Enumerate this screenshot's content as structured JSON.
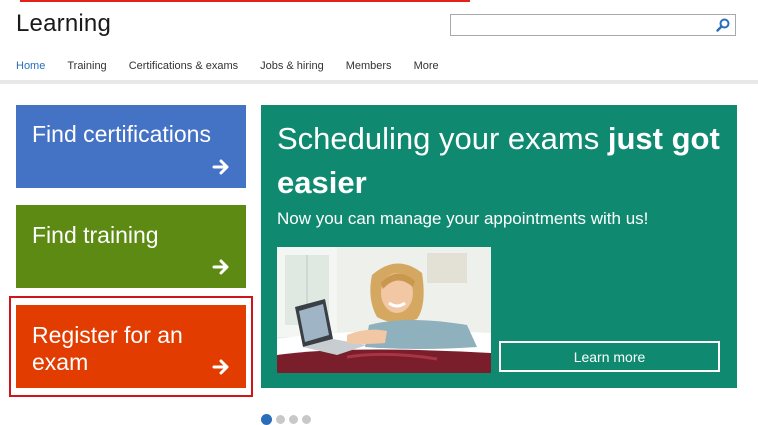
{
  "header": {
    "title": "Learning",
    "search": {
      "value": "",
      "placeholder": ""
    }
  },
  "nav": {
    "items": [
      {
        "label": "Home",
        "active": true
      },
      {
        "label": "Training"
      },
      {
        "label": "Certifications & exams"
      },
      {
        "label": "Jobs & hiring"
      },
      {
        "label": "Members"
      },
      {
        "label": "More"
      }
    ]
  },
  "tiles": [
    {
      "label": "Find certifications",
      "color": "#4472c4"
    },
    {
      "label": "Find training",
      "color": "#5c8a12"
    },
    {
      "label": "Register for an exam",
      "color": "#e23c00",
      "highlighted": true
    }
  ],
  "hero": {
    "title_normal": "Scheduling your exams ",
    "title_bold": "just got easier",
    "subtitle": "Now you can manage your appointments with us!",
    "button_label": "Learn more",
    "background": "#0f8a70"
  },
  "carousel": {
    "count": 4,
    "active": 1
  },
  "colors": {
    "accent": "#2a6ebb",
    "highlight": "#d0141c"
  }
}
